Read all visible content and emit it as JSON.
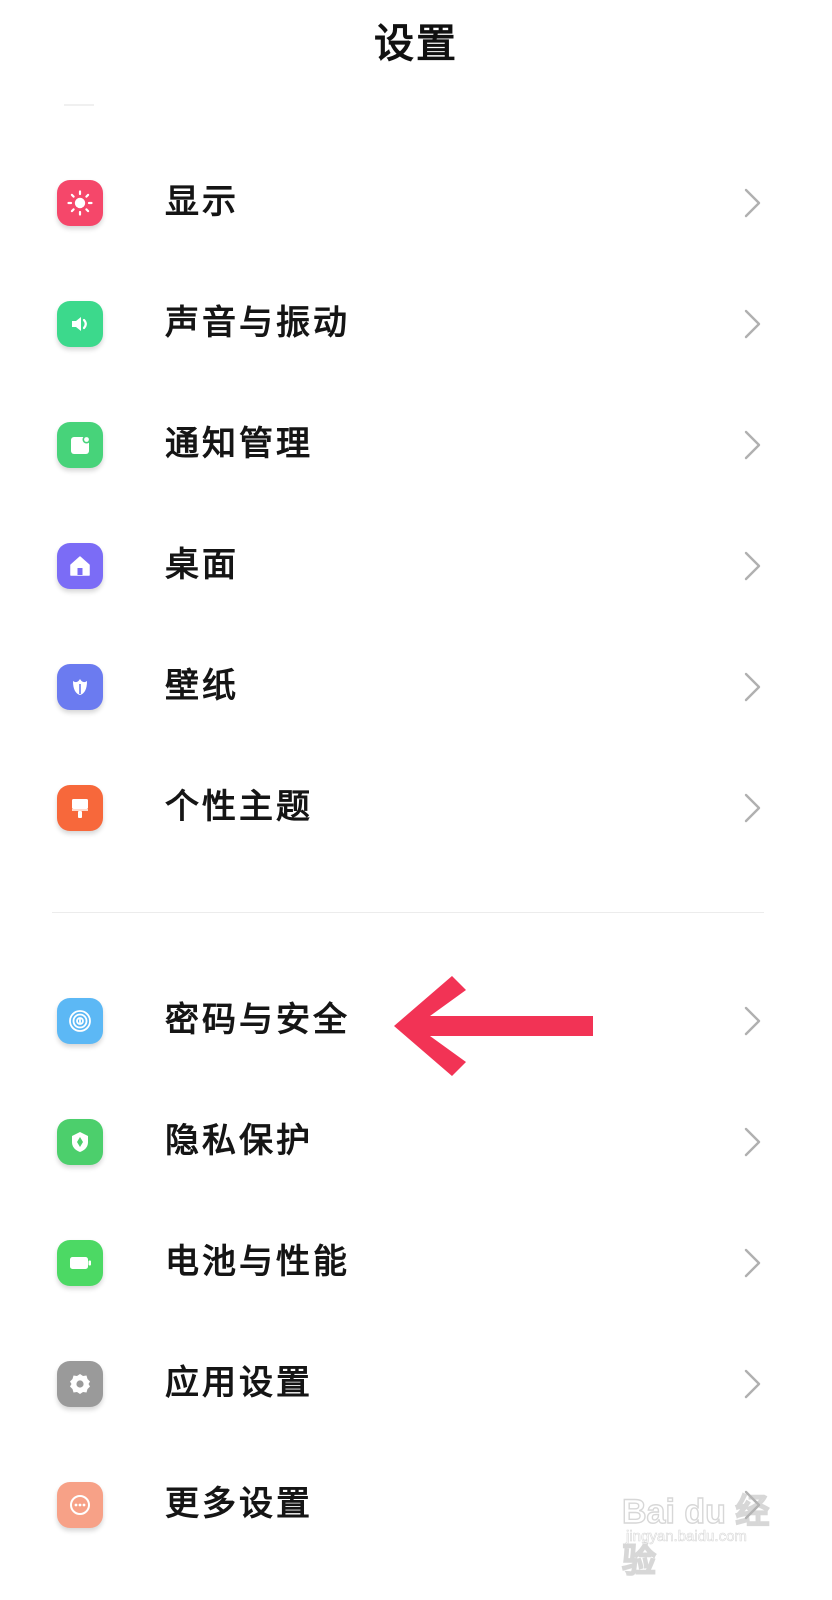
{
  "header": {
    "title": "设置"
  },
  "items": [
    {
      "label": "显示",
      "icon": "brightness-icon",
      "color": "#F5476A"
    },
    {
      "label": "声音与振动",
      "icon": "speaker-icon",
      "color": "#3CD98C"
    },
    {
      "label": "通知管理",
      "icon": "notification-icon",
      "color": "#47D37A"
    },
    {
      "label": "桌面",
      "icon": "home-icon",
      "color": "#7B6CF6"
    },
    {
      "label": "壁纸",
      "icon": "tulip-icon",
      "color": "#6B7BF0"
    },
    {
      "label": "个性主题",
      "icon": "paint-brush-icon",
      "color": "#F7683B"
    },
    {
      "label": "密码与安全",
      "icon": "fingerprint-icon",
      "color": "#5CB8F5"
    },
    {
      "label": "隐私保护",
      "icon": "shield-icon",
      "color": "#4CCF6C"
    },
    {
      "label": "电池与性能",
      "icon": "battery-icon",
      "color": "#4CD964"
    },
    {
      "label": "应用设置",
      "icon": "gear-icon",
      "color": "#9A9A9A"
    },
    {
      "label": "更多设置",
      "icon": "more-icon",
      "color": "#F7A187"
    }
  ],
  "annotation": {
    "arrow_color": "#F23355",
    "arrow_icon": "left-arrow-icon"
  },
  "watermark": {
    "logo": "Bai du 经验",
    "url": "jingyan.baidu.com"
  }
}
